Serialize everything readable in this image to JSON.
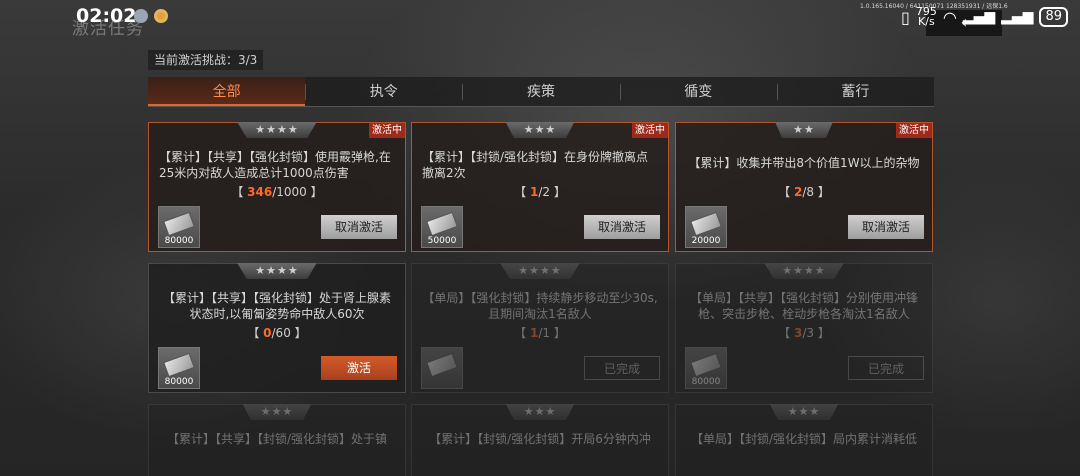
{
  "status": {
    "time": "02:02",
    "net_speed_value": "795",
    "net_speed_unit": "K/s",
    "battery": "89",
    "top_info": "1.0.165.16040 / 641150071 128351931 / 远保1.6"
  },
  "page_title": "激活任务",
  "back_icon": "‹",
  "challenge": "当前激活挑战：3/3",
  "tabs": [
    "全部",
    "执令",
    "疾策",
    "循变",
    "蓄行"
  ],
  "cards": [
    {
      "stars": "★★★★",
      "badge": "激活中",
      "desc": "【累计】【共享】【强化封锁】使用霰弹枪,在25米内对敌人造成总计1000点伤害",
      "cur": "346",
      "total": "/1000",
      "reward": "80000",
      "button": "取消激活"
    },
    {
      "stars": "★★★",
      "badge": "激活中",
      "desc": "【累计】【封锁/强化封锁】在身份牌撤离点撤离2次",
      "cur": "1",
      "total": "/2",
      "reward": "50000",
      "button": "取消激活"
    },
    {
      "stars": "★★",
      "badge": "激活中",
      "desc": "【累计】收集并带出8个价值1W以上的杂物",
      "cur": "2",
      "total": "/8",
      "reward": "20000",
      "button": "取消激活"
    },
    {
      "stars": "★★★★",
      "badge": "",
      "desc": "【累计】【共享】【强化封锁】处于肾上腺素状态时,以匍匐姿势命中敌人60次",
      "cur": "0",
      "total": "/60",
      "reward": "80000",
      "button": "激活"
    },
    {
      "stars": "★★★★",
      "badge": "",
      "desc": "【单局】【强化封锁】持续静步移动至少30s,且期间淘汰1名敌人",
      "cur": "1",
      "total": "/1",
      "reward": "",
      "button": "已完成"
    },
    {
      "stars": "★★★★",
      "badge": "",
      "desc": "【单局】【共享】【强化封锁】分别使用冲锋枪、突击步枪、栓动步枪各淘汰1名敌人",
      "cur": "3",
      "total": "/3",
      "reward": "80000",
      "button": "已完成"
    },
    {
      "stars": "★★★",
      "badge": "",
      "desc": "【累计】【共享】【封锁/强化封锁】处于镇"
    },
    {
      "stars": "★★★",
      "badge": "",
      "desc": "【累计】【封锁/强化封锁】开局6分钟内冲"
    },
    {
      "stars": "★★★",
      "badge": "",
      "desc": "【单局】【封锁/强化封锁】局内累计消耗低"
    }
  ]
}
